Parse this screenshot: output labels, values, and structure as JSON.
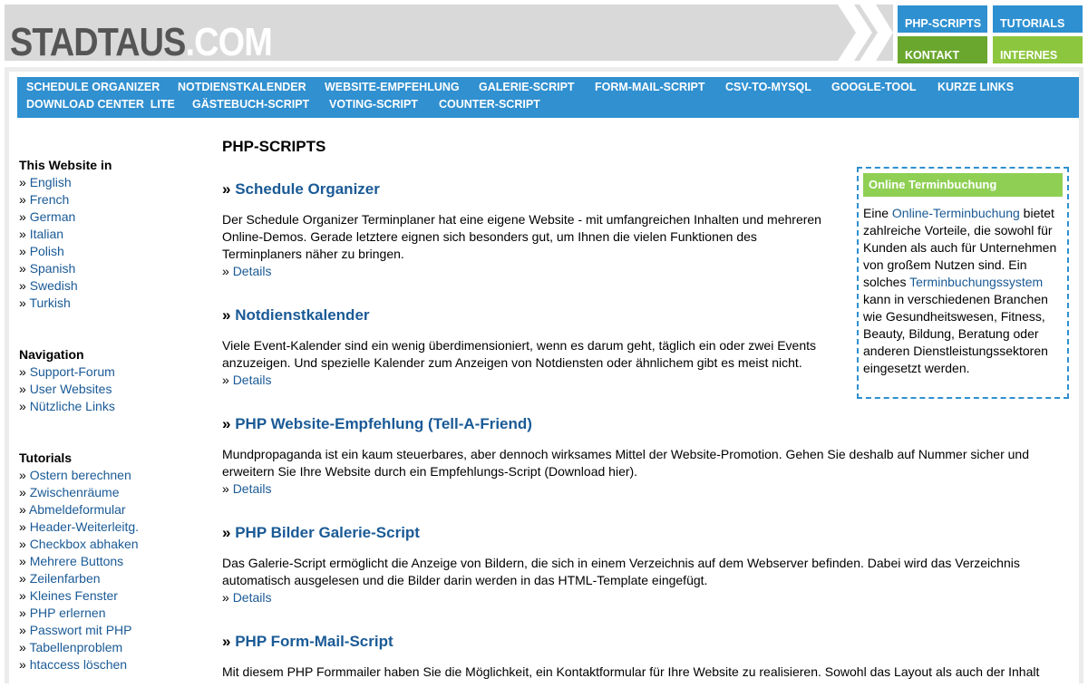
{
  "site": {
    "logo_main": "STADTAUS",
    "logo_tld": ".COM",
    "top_nav": {
      "php_scripts": "PHP-SCRIPTS",
      "tutorials": "TUTORIALS",
      "kontakt": "KONTAKT",
      "internes": "INTERNES"
    }
  },
  "main_nav": {
    "row1": [
      "SCHEDULE ORGANIZER",
      "NOTDIENSTKALENDER",
      "WEBSITE-EMPFEHLUNG",
      "GALERIE-SCRIPT",
      "FORM-MAIL-SCRIPT",
      "CSV-TO-MYSQL",
      "GOOGLE-TOOL",
      "KURZE LINKS"
    ],
    "row2": [
      "DOWNLOAD CENTER  LITE",
      "GÄSTEBUCH-SCRIPT",
      "VOTING-SCRIPT",
      "COUNTER-SCRIPT"
    ]
  },
  "sidebar": {
    "languages_title": "This Website in",
    "languages": [
      "English",
      "French",
      "German",
      "Italian",
      "Polish",
      "Spanish",
      "Swedish",
      "Turkish"
    ],
    "navigation_title": "Navigation",
    "navigation": [
      "Support-Forum",
      "User Websites",
      "Nützliche Links"
    ],
    "tutorials_title": "Tutorials",
    "tutorials": [
      "Ostern berechnen",
      "Zwischenräume",
      "Abmeldeformular",
      "Header-Weiterleitg.",
      "Checkbox abhaken",
      "Mehrere Buttons",
      "Zeilenfarben",
      "Kleines Fenster",
      "PHP erlernen",
      "Passwort mit PHP",
      "Tabellenproblem",
      "htaccess löschen"
    ]
  },
  "raquo": "»",
  "page_title": "PHP-SCRIPTS",
  "articles": [
    {
      "title": "Schedule Organizer",
      "lines": [
        "Der Schedule Organizer Terminplaner hat eine eigene Website - mit umfangreichen Inhalten und mehreren",
        "Online-Demos. Gerade letztere eignen sich besonders gut, um Ihnen die vielen Funktionen des",
        "Terminplaners näher zu bringen."
      ],
      "details": "Details"
    },
    {
      "title": "Notdienstkalender",
      "lines": [
        "Viele Event-Kalender sind ein wenig überdimensioniert, wenn es darum geht, täglich ein oder zwei Events",
        "anzuzeigen. Und spezielle Kalender zum Anzeigen von Notdiensten oder ähnlichem gibt es meist nicht."
      ],
      "details": "Details"
    },
    {
      "title": "PHP Website-Empfehlung (Tell-A-Friend)",
      "lines": [
        "Mundpropaganda ist ein kaum steuerbares, aber dennoch wirksames Mittel der Website-Promotion. Gehen Sie deshalb auf Nummer sicher und",
        "erweitern Sie Ihre Website durch ein Empfehlungs-Script (Download hier)."
      ],
      "details": "Details"
    },
    {
      "title": "PHP Bilder Galerie-Script",
      "lines": [
        "Das Galerie-Script ermöglicht die Anzeige von Bildern, die sich in einem Verzeichnis auf dem Webserver befinden. Dabei wird das Verzeichnis",
        "automatisch ausgelesen und die Bilder darin werden in das HTML-Template eingefügt."
      ],
      "details": "Details"
    },
    {
      "title": "PHP Form-Mail-Script",
      "lines": [
        "Mit diesem PHP Formmailer haben Sie die Möglichkeit, ein Kontaktformular für Ihre Website zu realisieren. Sowohl das Layout als auch der Inhalt"
      ],
      "details": ""
    }
  ],
  "infobox": {
    "title": "Online Terminbuchung",
    "text_1": "Eine ",
    "link_1": "Online-Terminbuchung",
    "text_2": " bietet zahlreiche Vorteile, die sowohl für Kunden als auch für Unternehmen von großem Nutzen sind. Ein solches ",
    "link_2": "Terminbuchungssystem",
    "text_3": " kann in verschiedenen Branchen wie Gesundheitswesen, Fitness, Beauty, Bildung, Beratung oder anderen Dienstleistungssektoren eingesetzt werden."
  }
}
